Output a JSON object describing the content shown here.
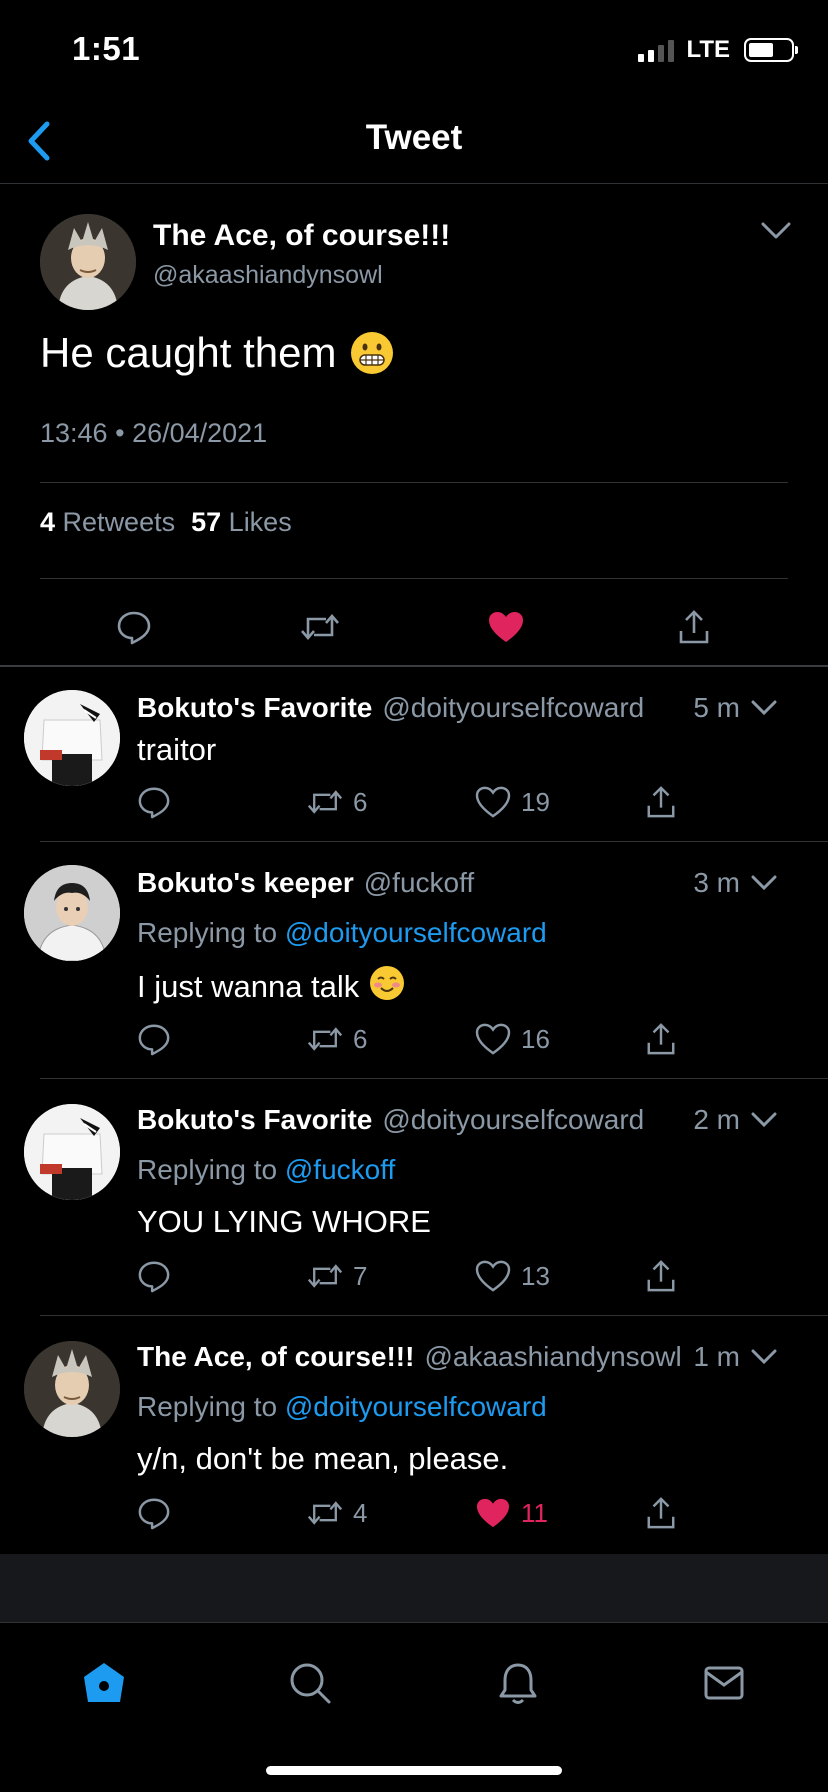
{
  "status_bar": {
    "time": "1:51",
    "network": "LTE"
  },
  "nav": {
    "title": "Tweet"
  },
  "main_tweet": {
    "name": "The Ace, of course!!!",
    "handle": "@akaashiandynsowl",
    "text": "He caught them",
    "emoji": "grimacing-face",
    "time": "13:46",
    "separator": "•",
    "date": "26/04/2021",
    "retweets_count": "4",
    "retweets_label": "Retweets",
    "likes_count": "57",
    "likes_label": "Likes",
    "liked": true
  },
  "replies": [
    {
      "name": "Bokuto's Favorite",
      "handle": "@doityourselfcoward",
      "time": "5 m",
      "replying_label": "",
      "replying_to": "",
      "text": "traitor",
      "retweets": "6",
      "likes": "19",
      "liked": false
    },
    {
      "name": "Bokuto's keeper",
      "handle": "@fuckoff",
      "time": "3 m",
      "replying_label": "Replying to",
      "replying_to": "@doityourselfcoward",
      "text": "I just wanna talk",
      "emoji": "smiling-face",
      "retweets": "6",
      "likes": "16",
      "liked": false
    },
    {
      "name": "Bokuto's Favorite",
      "handle": "@doityourselfcoward",
      "time": "2 m",
      "replying_label": "Replying to",
      "replying_to": "@fuckoff",
      "text": "YOU LYING WHORE",
      "retweets": "7",
      "likes": "13",
      "liked": false
    },
    {
      "name": "The Ace, of course!!!",
      "handle": "@akaashiandynsowl",
      "time": "1 m",
      "replying_label": "Replying to",
      "replying_to": "@doityourselfcoward",
      "text": "y/n, don't be mean, please.",
      "retweets": "4",
      "likes": "11",
      "liked": true
    }
  ],
  "tabbar": {
    "items": [
      "home-icon",
      "search-icon",
      "bell-icon",
      "mail-icon"
    ],
    "active": "home-icon"
  },
  "colors": {
    "accent": "#1d9bf0",
    "like": "#e0245e",
    "muted": "#8b98a5",
    "background": "#000000"
  }
}
